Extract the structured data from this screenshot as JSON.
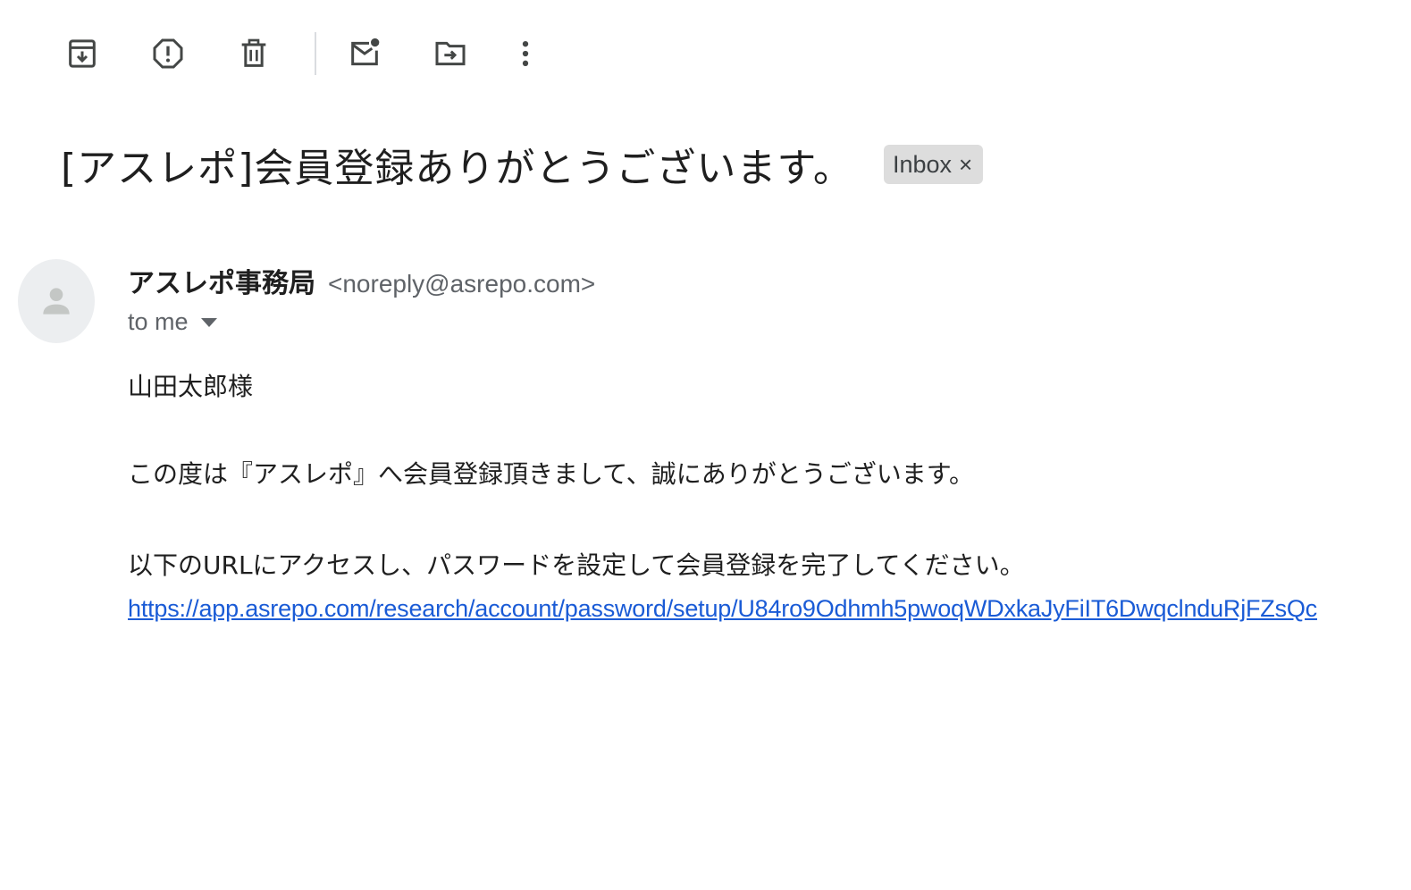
{
  "toolbar": {
    "buttons": [
      {
        "name": "archive",
        "icon": "archive-icon"
      },
      {
        "name": "report-spam",
        "icon": "report-spam-icon"
      },
      {
        "name": "delete",
        "icon": "trash-icon"
      },
      {
        "name": "mark-unread",
        "icon": "mark-unread-icon"
      },
      {
        "name": "move-to",
        "icon": "move-to-folder-icon"
      },
      {
        "name": "more",
        "icon": "more-vert-icon"
      }
    ]
  },
  "email": {
    "subject": "[アスレポ]会員登録ありがとうございます。",
    "label": "Inbox",
    "label_remove": "×",
    "sender_name": "アスレポ事務局",
    "sender_email": "<noreply@asrepo.com>",
    "to": "to me",
    "body": {
      "greeting": "山田太郎様",
      "paragraph1": "この度は『アスレポ』へ会員登録頂きまして、誠にありがとうございます。",
      "paragraph2": "以下のURLにアクセスし、パスワードを設定して会員登録を完了してください。",
      "link": "https://app.asrepo.com/research/account/password/setup/U84ro9Odhmh5pwoqWDxkaJyFiIT6DwqclnduRjFZsQc"
    }
  },
  "colors": {
    "background": "#ffffff",
    "text": "#1f1f1f",
    "secondary_text": "#5f6368",
    "icon": "#444746",
    "link": "#1a5bd6",
    "chip": "#dddddd",
    "avatar_bg": "#eceef0"
  }
}
